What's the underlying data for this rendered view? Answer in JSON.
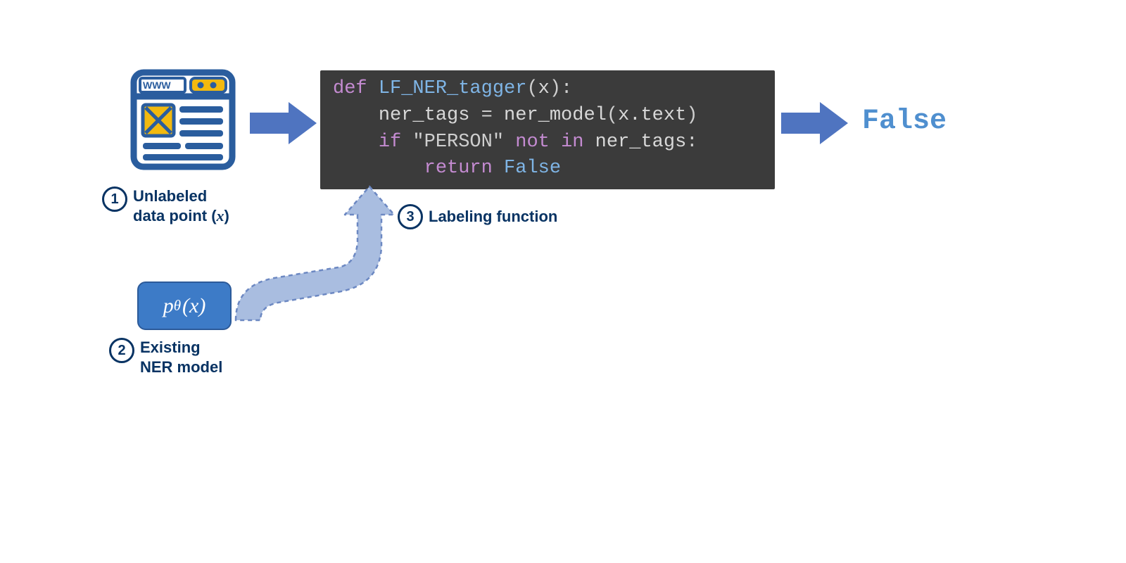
{
  "steps": {
    "s1": {
      "num": "1",
      "label_line1": "Unlabeled",
      "label_line2": "data point (",
      "label_var": "x",
      "label_line2_end": ")"
    },
    "s2": {
      "num": "2",
      "label_line1": "Existing",
      "label_line2": "NER model"
    },
    "s3": {
      "num": "3",
      "label": "Labeling function"
    }
  },
  "browser": {
    "url_text": "WWW"
  },
  "model_chip": {
    "p": "p",
    "theta": "θ",
    "arg": "(x)"
  },
  "code": {
    "kw_def": "def",
    "fn_name": "LF_NER_tagger",
    "paren_open": "(",
    "param": "x",
    "paren_close_colon": "):",
    "line2_lhs": "ner_tags",
    "eq": " = ",
    "call": "ner_model",
    "call_arg_open": "(",
    "call_arg": "x.text",
    "call_arg_close": ")",
    "kw_if": "if",
    "str_person": "\"PERSON\"",
    "kw_not": "not",
    "kw_in": "in",
    "rhs": "ner_tags",
    "colon": ":",
    "kw_return": "return",
    "val_false": "False"
  },
  "output": {
    "text": "False"
  },
  "colors": {
    "navy": "#083363",
    "codebg": "#3b3b3b",
    "arrow_solid": "#4f74c0",
    "arrow_light_fill": "#a9bde0",
    "arrow_light_stroke": "#6c88c2",
    "chip": "#3d7bc7",
    "yellow": "#f2b90f",
    "icon_blue": "#2a5d9e"
  }
}
